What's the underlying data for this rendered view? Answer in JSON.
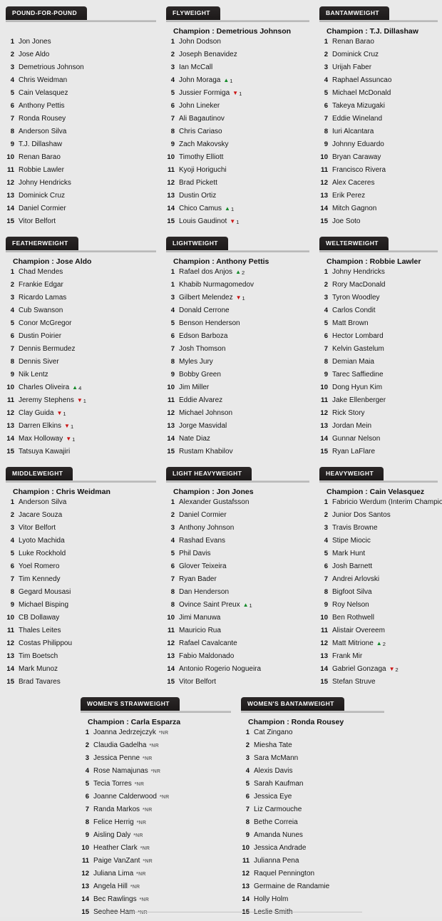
{
  "meta": {
    "champion_prefix": "Champion : ",
    "nr_marker": "*NR"
  },
  "rows": [
    {
      "divisions": [
        {
          "title": "POUND-FOR-POUND",
          "champion": "",
          "has_champion": false,
          "fighters": [
            {
              "rank": "1",
              "name": "Jon Jones"
            },
            {
              "rank": "2",
              "name": "Jose Aldo"
            },
            {
              "rank": "3",
              "name": "Demetrious Johnson"
            },
            {
              "rank": "4",
              "name": "Chris Weidman"
            },
            {
              "rank": "5",
              "name": "Cain Velasquez"
            },
            {
              "rank": "6",
              "name": "Anthony Pettis"
            },
            {
              "rank": "7",
              "name": "Ronda Rousey"
            },
            {
              "rank": "8",
              "name": "Anderson Silva"
            },
            {
              "rank": "9",
              "name": "T.J. Dillashaw"
            },
            {
              "rank": "10",
              "name": "Renan Barao"
            },
            {
              "rank": "11",
              "name": "Robbie Lawler"
            },
            {
              "rank": "12",
              "name": "Johny Hendricks"
            },
            {
              "rank": "13",
              "name": "Dominick Cruz"
            },
            {
              "rank": "14",
              "name": "Daniel Cormier"
            },
            {
              "rank": "15",
              "name": "Vitor Belfort"
            }
          ]
        },
        {
          "title": "FLYWEIGHT",
          "champion": "Champion : Demetrious Johnson",
          "has_champion": true,
          "fighters": [
            {
              "rank": "1",
              "name": "John Dodson"
            },
            {
              "rank": "2",
              "name": "Joseph Benavidez"
            },
            {
              "rank": "3",
              "name": "Ian McCall"
            },
            {
              "rank": "4",
              "name": "John Moraga",
              "move": "up",
              "amount": "1"
            },
            {
              "rank": "5",
              "name": "Jussier Formiga",
              "move": "down",
              "amount": "1"
            },
            {
              "rank": "6",
              "name": "John Lineker"
            },
            {
              "rank": "7",
              "name": "Ali Bagautinov"
            },
            {
              "rank": "8",
              "name": "Chris Cariaso"
            },
            {
              "rank": "9",
              "name": "Zach Makovsky"
            },
            {
              "rank": "10",
              "name": "Timothy Elliott"
            },
            {
              "rank": "11",
              "name": "Kyoji Horiguchi"
            },
            {
              "rank": "12",
              "name": "Brad Pickett"
            },
            {
              "rank": "13",
              "name": "Dustin Ortiz"
            },
            {
              "rank": "14",
              "name": "Chico Camus",
              "move": "up",
              "amount": "1"
            },
            {
              "rank": "15",
              "name": "Louis Gaudinot",
              "move": "down",
              "amount": "1"
            }
          ]
        },
        {
          "title": "BANTAMWEIGHT",
          "champion": "Champion : T.J. Dillashaw",
          "has_champion": true,
          "fighters": [
            {
              "rank": "1",
              "name": "Renan Barao"
            },
            {
              "rank": "2",
              "name": "Dominick Cruz"
            },
            {
              "rank": "3",
              "name": "Urijah Faber"
            },
            {
              "rank": "4",
              "name": "Raphael Assuncao"
            },
            {
              "rank": "5",
              "name": "Michael McDonald"
            },
            {
              "rank": "6",
              "name": "Takeya Mizugaki"
            },
            {
              "rank": "7",
              "name": "Eddie Wineland"
            },
            {
              "rank": "8",
              "name": "Iuri Alcantara"
            },
            {
              "rank": "9",
              "name": "Johnny Eduardo"
            },
            {
              "rank": "10",
              "name": "Bryan Caraway"
            },
            {
              "rank": "11",
              "name": "Francisco Rivera"
            },
            {
              "rank": "12",
              "name": "Alex Caceres"
            },
            {
              "rank": "13",
              "name": "Erik Perez"
            },
            {
              "rank": "14",
              "name": "Mitch Gagnon"
            },
            {
              "rank": "15",
              "name": "Joe Soto"
            }
          ]
        }
      ]
    },
    {
      "divisions": [
        {
          "title": "FEATHERWEIGHT",
          "champion": "Champion : Jose Aldo",
          "has_champion": true,
          "fighters": [
            {
              "rank": "1",
              "name": "Chad Mendes"
            },
            {
              "rank": "2",
              "name": "Frankie Edgar"
            },
            {
              "rank": "3",
              "name": "Ricardo Lamas"
            },
            {
              "rank": "4",
              "name": "Cub Swanson"
            },
            {
              "rank": "5",
              "name": "Conor McGregor"
            },
            {
              "rank": "6",
              "name": "Dustin Poirier"
            },
            {
              "rank": "7",
              "name": "Dennis Bermudez"
            },
            {
              "rank": "8",
              "name": "Dennis Siver"
            },
            {
              "rank": "9",
              "name": "Nik Lentz"
            },
            {
              "rank": "10",
              "name": "Charles Oliveira",
              "move": "up",
              "amount": "4"
            },
            {
              "rank": "11",
              "name": "Jeremy Stephens",
              "move": "down",
              "amount": "1"
            },
            {
              "rank": "12",
              "name": "Clay Guida",
              "move": "down",
              "amount": "1"
            },
            {
              "rank": "13",
              "name": "Darren Elkins",
              "move": "down",
              "amount": "1"
            },
            {
              "rank": "14",
              "name": "Max Holloway",
              "move": "down",
              "amount": "1"
            },
            {
              "rank": "15",
              "name": "Tatsuya Kawajiri"
            }
          ]
        },
        {
          "title": "LIGHTWEIGHT",
          "champion": "Champion : Anthony Pettis",
          "has_champion": true,
          "fighters": [
            {
              "rank": "1",
              "name": "Rafael dos Anjos",
              "move": "up",
              "amount": "2"
            },
            {
              "rank": "1",
              "name": "Khabib Nurmagomedov"
            },
            {
              "rank": "3",
              "name": "Gilbert Melendez",
              "move": "down",
              "amount": "1"
            },
            {
              "rank": "4",
              "name": "Donald Cerrone"
            },
            {
              "rank": "5",
              "name": "Benson Henderson"
            },
            {
              "rank": "6",
              "name": "Edson Barboza"
            },
            {
              "rank": "7",
              "name": "Josh Thomson"
            },
            {
              "rank": "8",
              "name": "Myles Jury"
            },
            {
              "rank": "9",
              "name": "Bobby Green"
            },
            {
              "rank": "10",
              "name": "Jim Miller"
            },
            {
              "rank": "11",
              "name": "Eddie Alvarez"
            },
            {
              "rank": "12",
              "name": "Michael Johnson"
            },
            {
              "rank": "13",
              "name": "Jorge Masvidal"
            },
            {
              "rank": "14",
              "name": "Nate Diaz"
            },
            {
              "rank": "15",
              "name": "Rustam Khabilov"
            }
          ]
        },
        {
          "title": "WELTERWEIGHT",
          "champion": "Champion : Robbie Lawler",
          "has_champion": true,
          "fighters": [
            {
              "rank": "1",
              "name": "Johny Hendricks"
            },
            {
              "rank": "2",
              "name": "Rory MacDonald"
            },
            {
              "rank": "3",
              "name": "Tyron Woodley"
            },
            {
              "rank": "4",
              "name": "Carlos Condit"
            },
            {
              "rank": "5",
              "name": "Matt Brown"
            },
            {
              "rank": "6",
              "name": "Hector Lombard"
            },
            {
              "rank": "7",
              "name": "Kelvin Gastelum"
            },
            {
              "rank": "8",
              "name": "Demian Maia"
            },
            {
              "rank": "9",
              "name": "Tarec Saffiedine"
            },
            {
              "rank": "10",
              "name": "Dong Hyun Kim"
            },
            {
              "rank": "11",
              "name": "Jake Ellenberger"
            },
            {
              "rank": "12",
              "name": "Rick Story"
            },
            {
              "rank": "13",
              "name": "Jordan Mein"
            },
            {
              "rank": "14",
              "name": "Gunnar Nelson"
            },
            {
              "rank": "15",
              "name": "Ryan LaFlare"
            }
          ]
        }
      ]
    },
    {
      "divisions": [
        {
          "title": "MIDDLEWEIGHT",
          "champion": "Champion : Chris Weidman",
          "has_champion": true,
          "fighters": [
            {
              "rank": "1",
              "name": "Anderson Silva"
            },
            {
              "rank": "2",
              "name": "Jacare Souza"
            },
            {
              "rank": "3",
              "name": "Vitor Belfort"
            },
            {
              "rank": "4",
              "name": "Lyoto Machida"
            },
            {
              "rank": "5",
              "name": "Luke Rockhold"
            },
            {
              "rank": "6",
              "name": "Yoel Romero"
            },
            {
              "rank": "7",
              "name": "Tim Kennedy"
            },
            {
              "rank": "8",
              "name": "Gegard Mousasi"
            },
            {
              "rank": "9",
              "name": "Michael Bisping"
            },
            {
              "rank": "10",
              "name": "CB Dollaway"
            },
            {
              "rank": "11",
              "name": "Thales Leites"
            },
            {
              "rank": "12",
              "name": "Costas Philippou"
            },
            {
              "rank": "13",
              "name": "Tim Boetsch"
            },
            {
              "rank": "14",
              "name": "Mark Munoz"
            },
            {
              "rank": "15",
              "name": "Brad Tavares"
            }
          ]
        },
        {
          "title": "LIGHT HEAVYWEIGHT",
          "champion": "Champion : Jon Jones",
          "has_champion": true,
          "fighters": [
            {
              "rank": "1",
              "name": "Alexander Gustafsson"
            },
            {
              "rank": "2",
              "name": "Daniel Cormier"
            },
            {
              "rank": "3",
              "name": "Anthony Johnson"
            },
            {
              "rank": "4",
              "name": "Rashad Evans"
            },
            {
              "rank": "5",
              "name": "Phil Davis"
            },
            {
              "rank": "6",
              "name": "Glover Teixeira"
            },
            {
              "rank": "7",
              "name": "Ryan Bader"
            },
            {
              "rank": "8",
              "name": "Dan Henderson"
            },
            {
              "rank": "8",
              "name": "Ovince Saint Preux",
              "move": "up",
              "amount": "1"
            },
            {
              "rank": "10",
              "name": "Jimi Manuwa"
            },
            {
              "rank": "11",
              "name": "Mauricio Rua"
            },
            {
              "rank": "12",
              "name": "Rafael Cavalcante"
            },
            {
              "rank": "13",
              "name": "Fabio Maldonado"
            },
            {
              "rank": "14",
              "name": "Antonio Rogerio Nogueira"
            },
            {
              "rank": "15",
              "name": "Vitor Belfort"
            }
          ]
        },
        {
          "title": "HEAVYWEIGHT",
          "champion": "Champion : Cain Velasquez",
          "has_champion": true,
          "fighters": [
            {
              "rank": "1",
              "name": "Fabricio Werdum (Interim Champion)"
            },
            {
              "rank": "2",
              "name": "Junior Dos Santos"
            },
            {
              "rank": "3",
              "name": "Travis Browne"
            },
            {
              "rank": "4",
              "name": "Stipe Miocic"
            },
            {
              "rank": "5",
              "name": "Mark Hunt"
            },
            {
              "rank": "6",
              "name": "Josh Barnett"
            },
            {
              "rank": "7",
              "name": "Andrei Arlovski"
            },
            {
              "rank": "8",
              "name": "Bigfoot Silva"
            },
            {
              "rank": "9",
              "name": "Roy Nelson"
            },
            {
              "rank": "10",
              "name": "Ben Rothwell"
            },
            {
              "rank": "11",
              "name": "Alistair Overeem"
            },
            {
              "rank": "12",
              "name": "Matt Mitrione",
              "move": "up",
              "amount": "2"
            },
            {
              "rank": "13",
              "name": "Frank Mir"
            },
            {
              "rank": "14",
              "name": "Gabriel Gonzaga",
              "move": "down",
              "amount": "2"
            },
            {
              "rank": "15",
              "name": "Stefan Struve"
            }
          ]
        }
      ]
    },
    {
      "centered": true,
      "divisions": [
        {
          "title": "WOMEN'S STRAWWEIGHT",
          "champion": "Champion : Carla Esparza",
          "has_champion": true,
          "fighters": [
            {
              "rank": "1",
              "name": "Joanna Jedrzejczyk",
              "nr": "*NR"
            },
            {
              "rank": "2",
              "name": "Claudia Gadelha",
              "nr": "*NR"
            },
            {
              "rank": "3",
              "name": "Jessica Penne",
              "nr": "*NR"
            },
            {
              "rank": "4",
              "name": "Rose Namajunas",
              "nr": "*NR"
            },
            {
              "rank": "5",
              "name": "Tecia Torres",
              "nr": "*NR"
            },
            {
              "rank": "6",
              "name": "Joanne Calderwood",
              "nr": "*NR"
            },
            {
              "rank": "7",
              "name": "Randa Markos",
              "nr": "*NR"
            },
            {
              "rank": "8",
              "name": "Felice Herrig",
              "nr": "*NR"
            },
            {
              "rank": "9",
              "name": "Aisling Daly",
              "nr": "*NR"
            },
            {
              "rank": "10",
              "name": "Heather Clark",
              "nr": "*NR"
            },
            {
              "rank": "11",
              "name": "Paige VanZant",
              "nr": "*NR"
            },
            {
              "rank": "12",
              "name": "Juliana Lima",
              "nr": "*NR"
            },
            {
              "rank": "13",
              "name": "Angela Hill",
              "nr": "*NR"
            },
            {
              "rank": "14",
              "name": "Bec Rawlings",
              "nr": "*NR"
            },
            {
              "rank": "15",
              "name": "Seohee Ham",
              "nr": "*NR"
            }
          ]
        },
        {
          "title": "WOMEN'S BANTAMWEIGHT",
          "champion": "Champion : Ronda Rousey",
          "has_champion": true,
          "fighters": [
            {
              "rank": "1",
              "name": "Cat Zingano"
            },
            {
              "rank": "2",
              "name": "Miesha Tate"
            },
            {
              "rank": "3",
              "name": "Sara McMann"
            },
            {
              "rank": "4",
              "name": "Alexis Davis"
            },
            {
              "rank": "5",
              "name": "Sarah Kaufman"
            },
            {
              "rank": "6",
              "name": "Jessica Eye"
            },
            {
              "rank": "7",
              "name": "Liz Carmouche"
            },
            {
              "rank": "8",
              "name": "Bethe Correia"
            },
            {
              "rank": "9",
              "name": "Amanda Nunes"
            },
            {
              "rank": "10",
              "name": "Jessica Andrade"
            },
            {
              "rank": "11",
              "name": "Julianna Pena"
            },
            {
              "rank": "12",
              "name": "Raquel Pennington"
            },
            {
              "rank": "13",
              "name": "Germaine de Randamie"
            },
            {
              "rank": "14",
              "name": "Holly Holm"
            },
            {
              "rank": "15",
              "name": "Leslie Smith"
            }
          ]
        }
      ]
    }
  ]
}
